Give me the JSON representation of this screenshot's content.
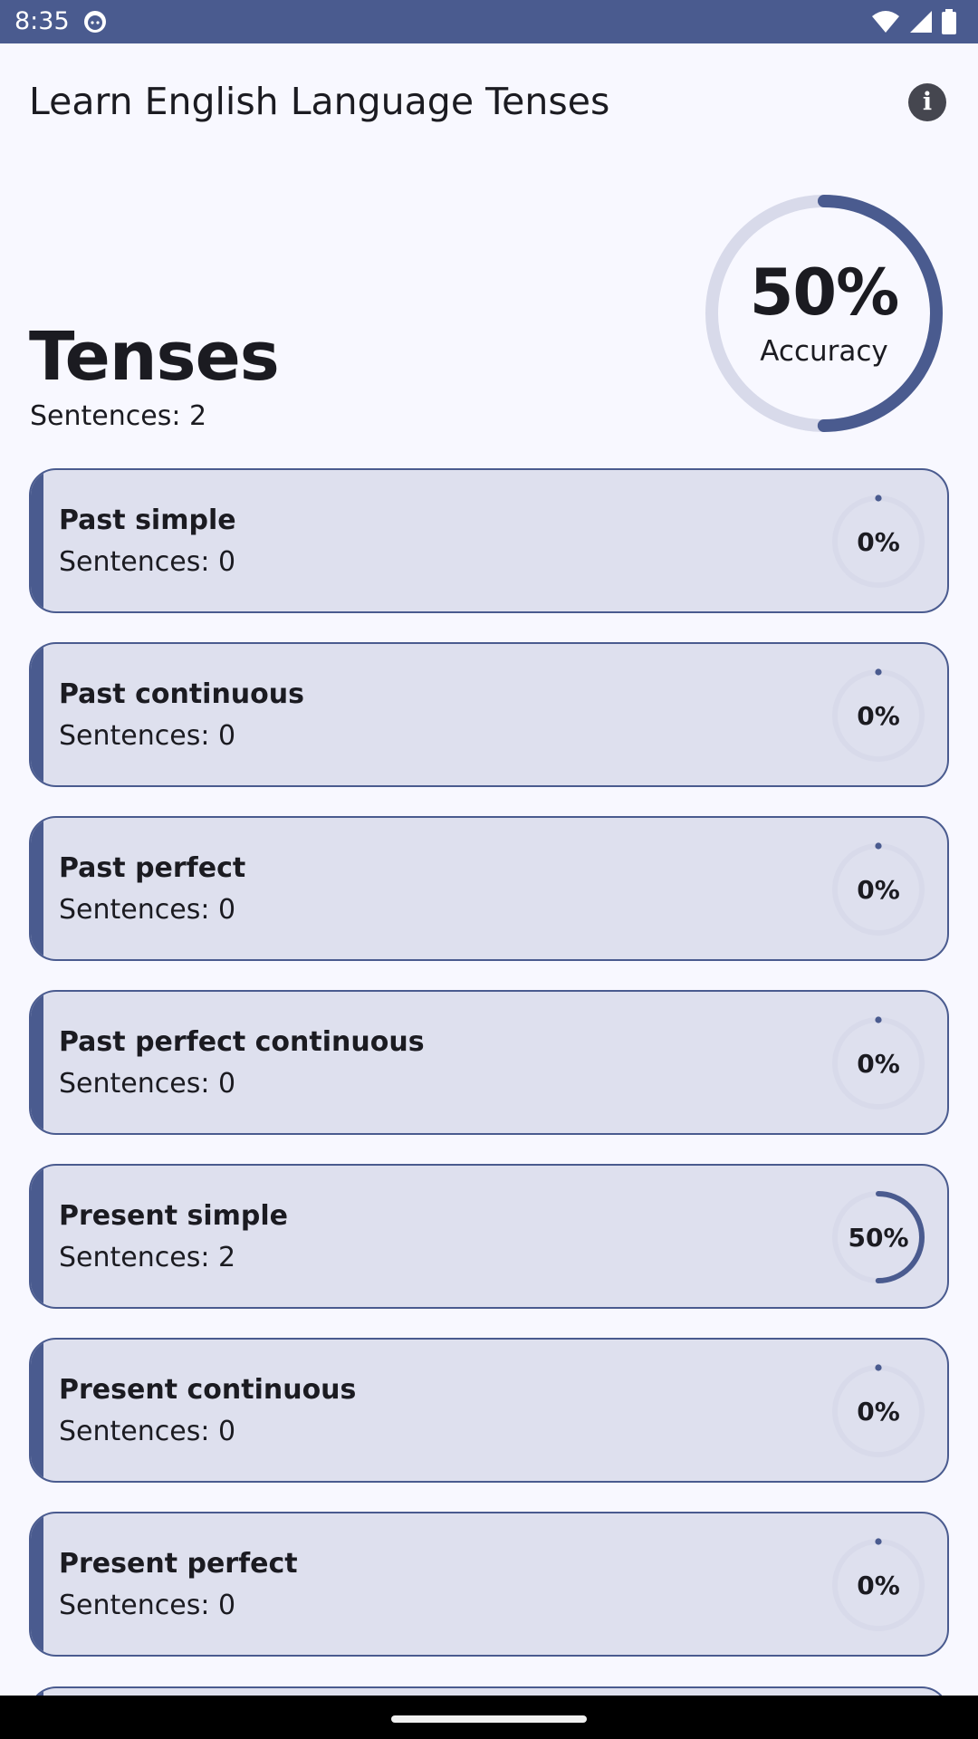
{
  "status_bar": {
    "time": "8:35",
    "app_icon": "android-face-icon",
    "icons": [
      "wifi-icon",
      "signal-icon",
      "battery-icon"
    ]
  },
  "app_bar": {
    "title": "Learn English Language Tenses",
    "info_icon": "info-icon",
    "info_glyph": "i"
  },
  "summary": {
    "title": "Tenses",
    "sentences": "Sentences: 2",
    "accuracy_value": "50%",
    "accuracy_label": "Accuracy",
    "accuracy_fraction": 0.5
  },
  "colors": {
    "primary": "#4a5b8f",
    "track": "#d8daea",
    "card_bg": "#dee0ee",
    "background": "#f8f8ff"
  },
  "tenses": [
    {
      "name": "Past simple",
      "sentences": "Sentences: 0",
      "percent": "0%",
      "fraction": 0
    },
    {
      "name": "Past continuous",
      "sentences": "Sentences: 0",
      "percent": "0%",
      "fraction": 0
    },
    {
      "name": "Past perfect",
      "sentences": "Sentences: 0",
      "percent": "0%",
      "fraction": 0
    },
    {
      "name": "Past perfect continuous",
      "sentences": "Sentences: 0",
      "percent": "0%",
      "fraction": 0
    },
    {
      "name": "Present simple",
      "sentences": "Sentences: 2",
      "percent": "50%",
      "fraction": 0.5
    },
    {
      "name": "Present continuous",
      "sentences": "Sentences: 0",
      "percent": "0%",
      "fraction": 0
    },
    {
      "name": "Present perfect",
      "sentences": "Sentences: 0",
      "percent": "0%",
      "fraction": 0
    }
  ]
}
